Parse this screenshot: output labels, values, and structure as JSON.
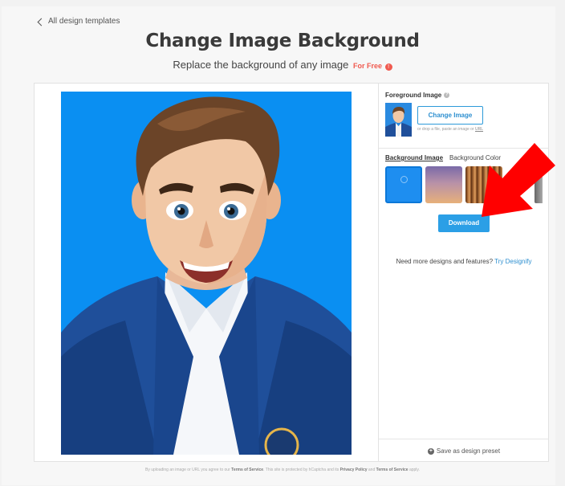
{
  "nav": {
    "back_label": "All design templates"
  },
  "header": {
    "title": "Change Image Background",
    "subtitle": "Replace the background of any image",
    "free_badge": "For Free",
    "badge_icon": "!"
  },
  "foreground": {
    "title": "Foreground Image",
    "change_button": "Change Image",
    "hint_prefix": "or drop a file, paste an image or",
    "hint_url": "URL"
  },
  "background": {
    "tabs": [
      {
        "label": "Background Image",
        "active": true
      },
      {
        "label": "Background Color",
        "active": false
      }
    ],
    "swatches": [
      {
        "name": "solid-blue",
        "color": "#1e8ef0",
        "selected": true
      },
      {
        "name": "sunset-gradient",
        "color": "#b891a8",
        "selected": false
      },
      {
        "name": "wood-stripes",
        "color": "#b0703a",
        "selected": false
      }
    ],
    "download_label": "Download"
  },
  "promo": {
    "text": "Need more designs and features?",
    "link": "Try Designify"
  },
  "save_preset": "Save as design preset",
  "footer": {
    "prefix": "By uploading an image or URL you agree to our",
    "tos": "Terms of Service",
    "middle": ". This site is protected by hCaptcha and its",
    "privacy": "Privacy Policy",
    "and": "and",
    "tos2": "Terms of Service",
    "suffix": "apply."
  },
  "colors": {
    "accent": "#2b9fe6",
    "free_red": "#f05a4f",
    "photo_bg": "#0a8ff2",
    "arrow": "#ff0000"
  }
}
